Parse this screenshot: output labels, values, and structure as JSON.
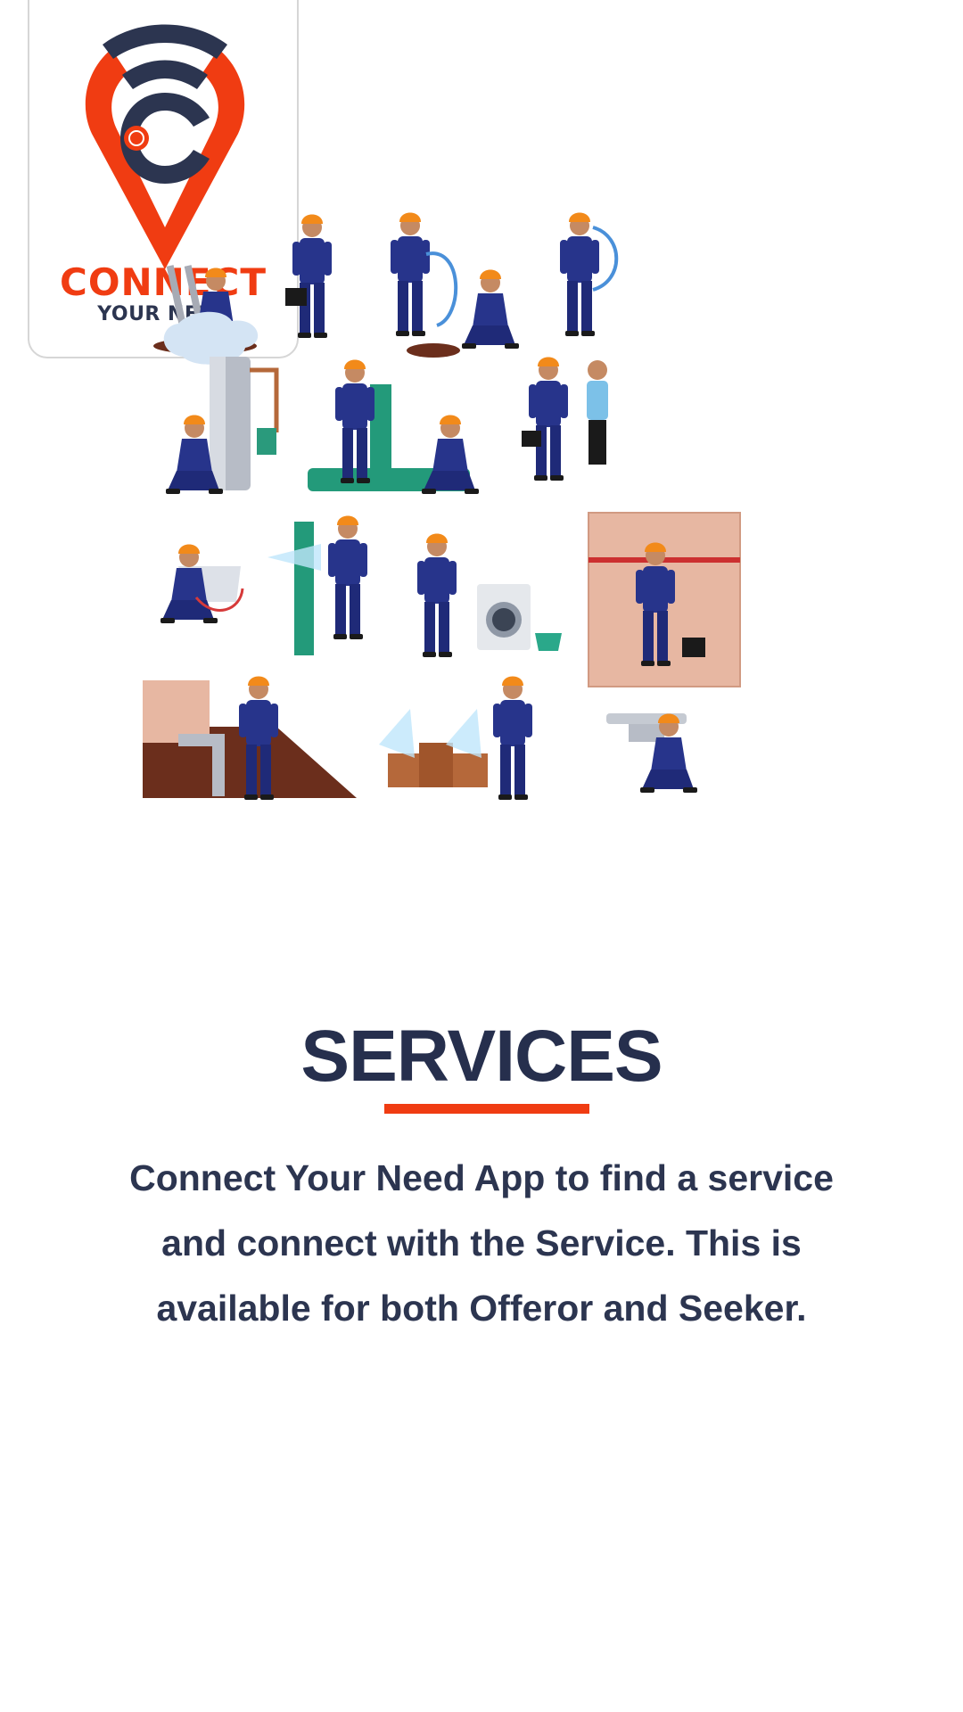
{
  "brand": {
    "name": "CONNECT",
    "tagline": "YOUR NEED",
    "logo_icon": "location-pin-wifi-c-icon",
    "colors": {
      "accent": "#f03c12",
      "navy": "#262f4d"
    }
  },
  "illustration": {
    "icon": "plumbers-at-work-illustration"
  },
  "intro": {
    "title": "SERVICES",
    "description": "Connect Your Need App to find a service and connect with the Service. This is available for both Offeror and Seeker."
  }
}
